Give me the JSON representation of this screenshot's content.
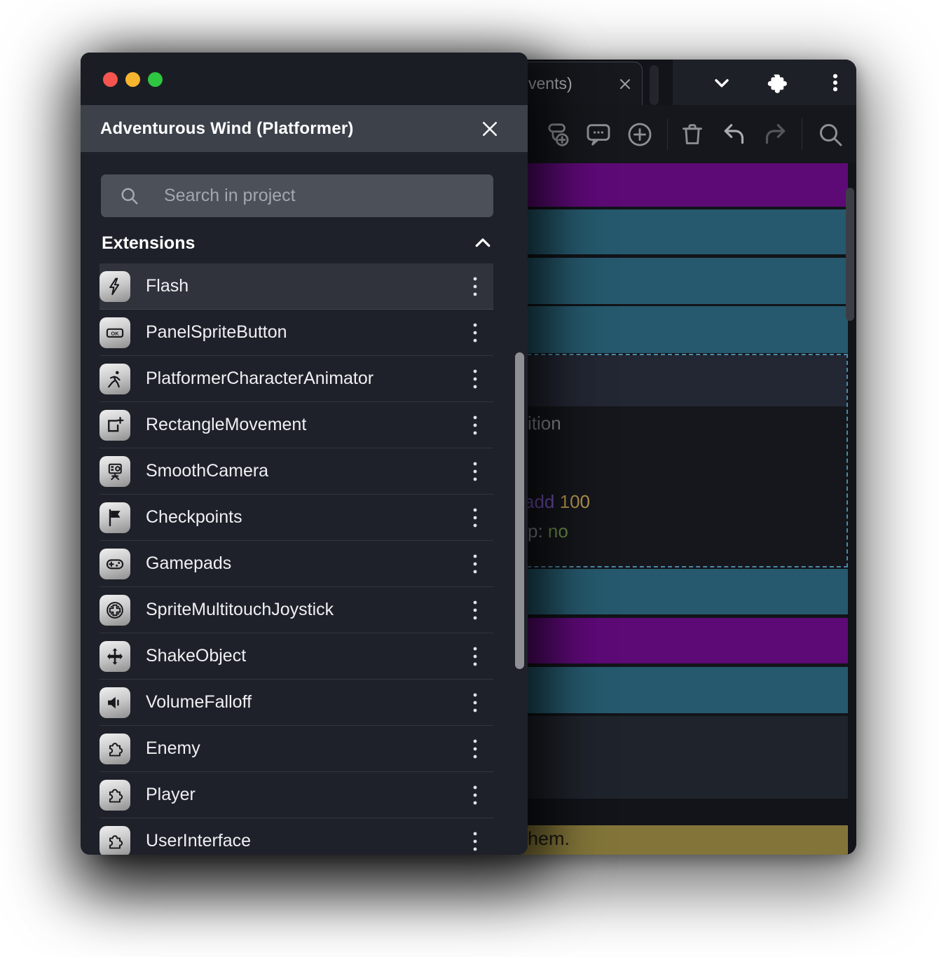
{
  "panel": {
    "title": "Adventurous Wind (Platformer)",
    "search": {
      "placeholder": "Search in project"
    },
    "section": {
      "label": "Extensions"
    },
    "extensions": [
      {
        "name": "Flash",
        "icon": "flash-icon"
      },
      {
        "name": "PanelSpriteButton",
        "icon": "ok-button-icon"
      },
      {
        "name": "PlatformerCharacterAnimator",
        "icon": "runner-icon"
      },
      {
        "name": "RectangleMovement",
        "icon": "rectangle-plus-icon"
      },
      {
        "name": "SmoothCamera",
        "icon": "camera-icon"
      },
      {
        "name": "Checkpoints",
        "icon": "flag-icon"
      },
      {
        "name": "Gamepads",
        "icon": "gamepad-icon"
      },
      {
        "name": "SpriteMultitouchJoystick",
        "icon": "joystick-icon"
      },
      {
        "name": "ShakeObject",
        "icon": "move-arrows-icon"
      },
      {
        "name": "VolumeFalloff",
        "icon": "speaker-icon"
      },
      {
        "name": "Enemy",
        "icon": "puzzle-icon"
      },
      {
        "name": "Player",
        "icon": "puzzle-icon"
      },
      {
        "name": "UserInterface",
        "icon": "puzzle-icon"
      }
    ]
  },
  "editor": {
    "tab": {
      "label_fragment": "vents)"
    },
    "topbar_icons": [
      "chevron-down",
      "extensions-puzzle",
      "more-menu"
    ],
    "toolbar_icons": [
      "add-sub-event",
      "add-comment",
      "add-event",
      "delete",
      "undo",
      "redo",
      "search"
    ],
    "selected_event": {
      "condition_fragment": "ition",
      "action_keyword": "add",
      "action_value": "100",
      "param_label": "p:",
      "param_value": "no"
    },
    "comment_fragment": "hem."
  },
  "colors": {
    "event_teal": "#26596d",
    "event_purple": "#5d0a76",
    "comment_yellow": "#837539",
    "selection_dashed_border": "#4d89a8",
    "panel_header": "#3d414a",
    "action_keyword_purple": "#7a55c0",
    "action_value_gold": "#b5954e",
    "boolean_no_green": "#6f8f4a",
    "traffic_red": "#f5554e",
    "traffic_yellow": "#f7b52e",
    "traffic_green": "#2fc641"
  }
}
